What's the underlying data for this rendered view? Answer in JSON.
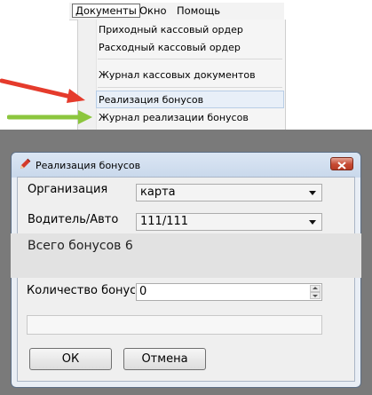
{
  "menubar": {
    "items": [
      "Документы",
      "Окно",
      "Помощь"
    ]
  },
  "dropdown": {
    "items": [
      "Приходный кассовый ордер",
      "Расходный кассовый ордер",
      "Журнал кассовых документов",
      "Реализация бонусов",
      "Журнал реализации бонусов"
    ]
  },
  "arrows": {
    "red_color": "#e53b2c",
    "green_color": "#8cc63e"
  },
  "dialog": {
    "title": "Реализация бонусов",
    "organization_label": "Организация",
    "organization_value": "карта",
    "driver_label": "Водитель/Авто",
    "driver_value": "111/111",
    "total_bonus_text": "Всего бонусов 6",
    "quantity_label": "Количество бонусов",
    "quantity_value": "0",
    "progress_value": 0,
    "ok_label": "ОК",
    "cancel_label": "Отмена",
    "close_color": "#c64a33"
  }
}
